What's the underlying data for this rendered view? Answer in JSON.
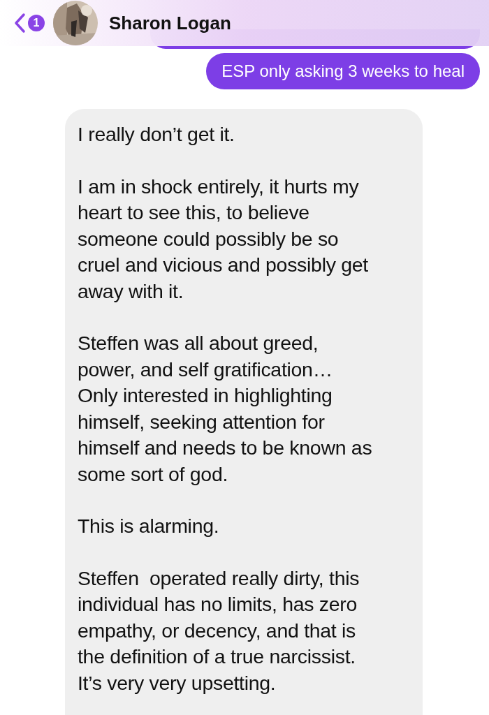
{
  "header": {
    "unread_count": "1",
    "contact_name": "Sharon Logan"
  },
  "sent_messages": [
    {
      "kind": "partial"
    },
    {
      "kind": "full",
      "text": "ESP only asking 3 weeks to heal"
    }
  ],
  "received_message": {
    "paragraphs": [
      {
        "lines": [
          "I really don’t get it."
        ]
      },
      {
        "lines": [
          "I am in shock entirely, it hurts my",
          "heart to see this, to believe",
          "someone could possibly be so",
          "cruel and vicious and possibly get",
          "away with it."
        ]
      },
      {
        "lines": [
          "Steffen was all about greed,",
          "power, and self gratification…",
          "Only interested in highlighting",
          "himself, seeking attention for",
          "himself and needs to be known as",
          "some sort of god."
        ]
      },
      {
        "lines": [
          "This is alarming."
        ]
      },
      {
        "lines": [
          "Steffen  operated really dirty, this",
          "individual has no limits, has zero",
          "empathy, or decency, and that is",
          "the definition of a true narcissist.",
          "It’s very very upsetting."
        ]
      }
    ]
  }
}
